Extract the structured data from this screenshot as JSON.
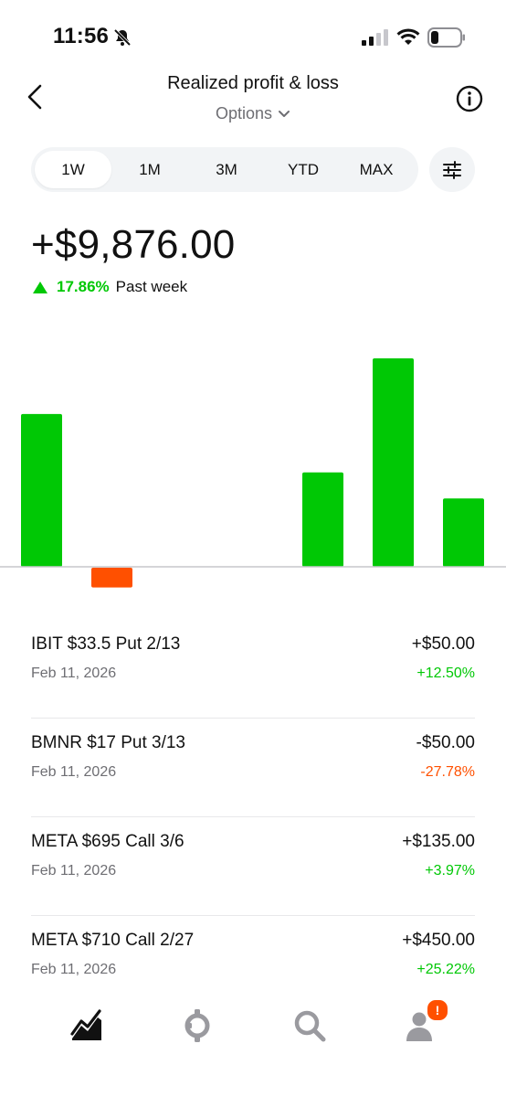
{
  "status_bar": {
    "time": "11:56"
  },
  "header": {
    "title": "Realized profit & loss",
    "subtitle": "Options"
  },
  "periods": [
    "1W",
    "1M",
    "3M",
    "YTD",
    "MAX"
  ],
  "active_period": "1W",
  "summary": {
    "total": "+$9,876.00",
    "change_pct": "17.86%",
    "change_label": "Past week"
  },
  "colors": {
    "gain": "#00c805",
    "loss": "#ff5000",
    "baseline": "#c7c7cc",
    "badge": "#ff5000"
  },
  "chart_data": {
    "type": "bar",
    "series": [
      {
        "values": [
          1700,
          -220,
          0,
          0,
          1050,
          2320,
          760
        ]
      }
    ],
    "baseline": 0,
    "grid": false
  },
  "transactions": [
    {
      "name": "IBIT $33.5 Put 2/13",
      "date": "Feb 11, 2026",
      "amount": "+$50.00",
      "pct": "+12.50%",
      "direction": "gain"
    },
    {
      "name": "BMNR $17 Put 3/13",
      "date": "Feb 11, 2026",
      "amount": "-$50.00",
      "pct": "-27.78%",
      "direction": "loss"
    },
    {
      "name": "META $695 Call 3/6",
      "date": "Feb 11, 2026",
      "amount": "+$135.00",
      "pct": "+3.97%",
      "direction": "gain"
    },
    {
      "name": "META $710 Call 2/27",
      "date": "Feb 11, 2026",
      "amount": "+$450.00",
      "pct": "+25.22%",
      "direction": "gain"
    }
  ],
  "nav": {
    "items": [
      "investing-chart-icon",
      "crypto-icon",
      "search-icon",
      "account-icon"
    ],
    "account_badge": "!"
  }
}
